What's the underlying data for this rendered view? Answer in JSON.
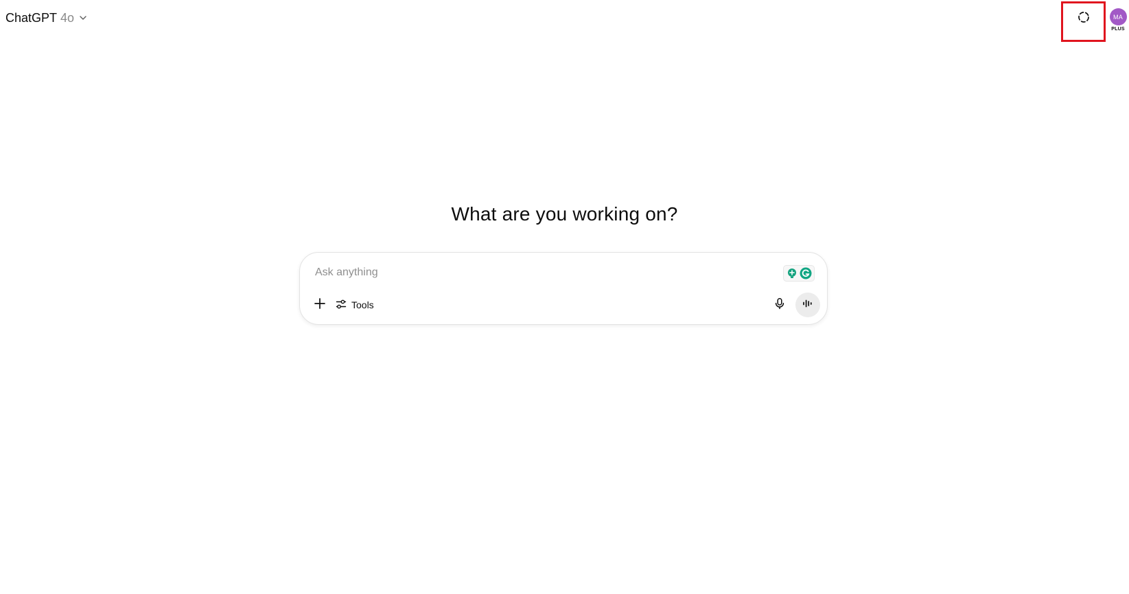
{
  "header": {
    "model_name": "ChatGPT",
    "model_version": "4o",
    "temporary_chat_icon": "dashed-circle-icon",
    "avatar_initials": "MA",
    "plan_badge": "PLUS",
    "avatar_color": "#a259c6",
    "highlight_color": "#e0141e"
  },
  "main": {
    "heading": "What are you working on?"
  },
  "composer": {
    "placeholder": "Ask anything",
    "value": "",
    "attach_icon": "plus-icon",
    "tools_label": "Tools",
    "tools_icon": "sliders-icon",
    "extension_icons": [
      "lightbulb-plus-icon",
      "grammarly-icon"
    ],
    "dictate_icon": "microphone-icon",
    "voice_icon": "voice-waveform-icon"
  }
}
